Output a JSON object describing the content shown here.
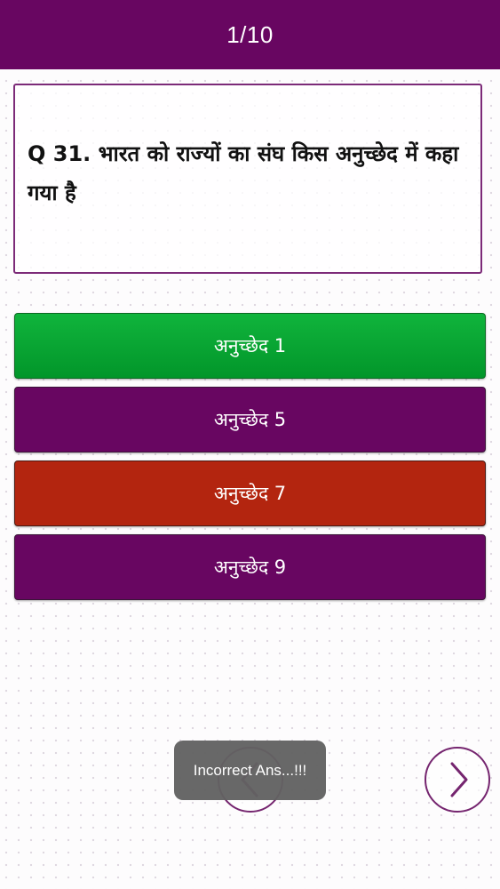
{
  "header": {
    "counter": "1/10"
  },
  "question": {
    "text": "Q 31. भारत को राज्यों का संघ किस अनुच्छेद में कहा गया है"
  },
  "options": [
    {
      "label": "अनुच्छेद 1",
      "state": "correct",
      "color": "#05a532"
    },
    {
      "label": "अनुच्छेद 5",
      "state": "default",
      "color": "#680661"
    },
    {
      "label": "अनुच्छेद 7",
      "state": "incorrect",
      "color": "#b3250f"
    },
    {
      "label": "अनुच्छेद 9",
      "state": "default",
      "color": "#680661"
    }
  ],
  "navigation": {
    "prev_icon": "chevron-left-icon",
    "next_icon": "chevron-right-icon"
  },
  "toast": {
    "message": "Incorrect Ans...!!!"
  },
  "colors": {
    "primary": "#680661",
    "correct": "#05a532",
    "incorrect": "#b3250f"
  }
}
